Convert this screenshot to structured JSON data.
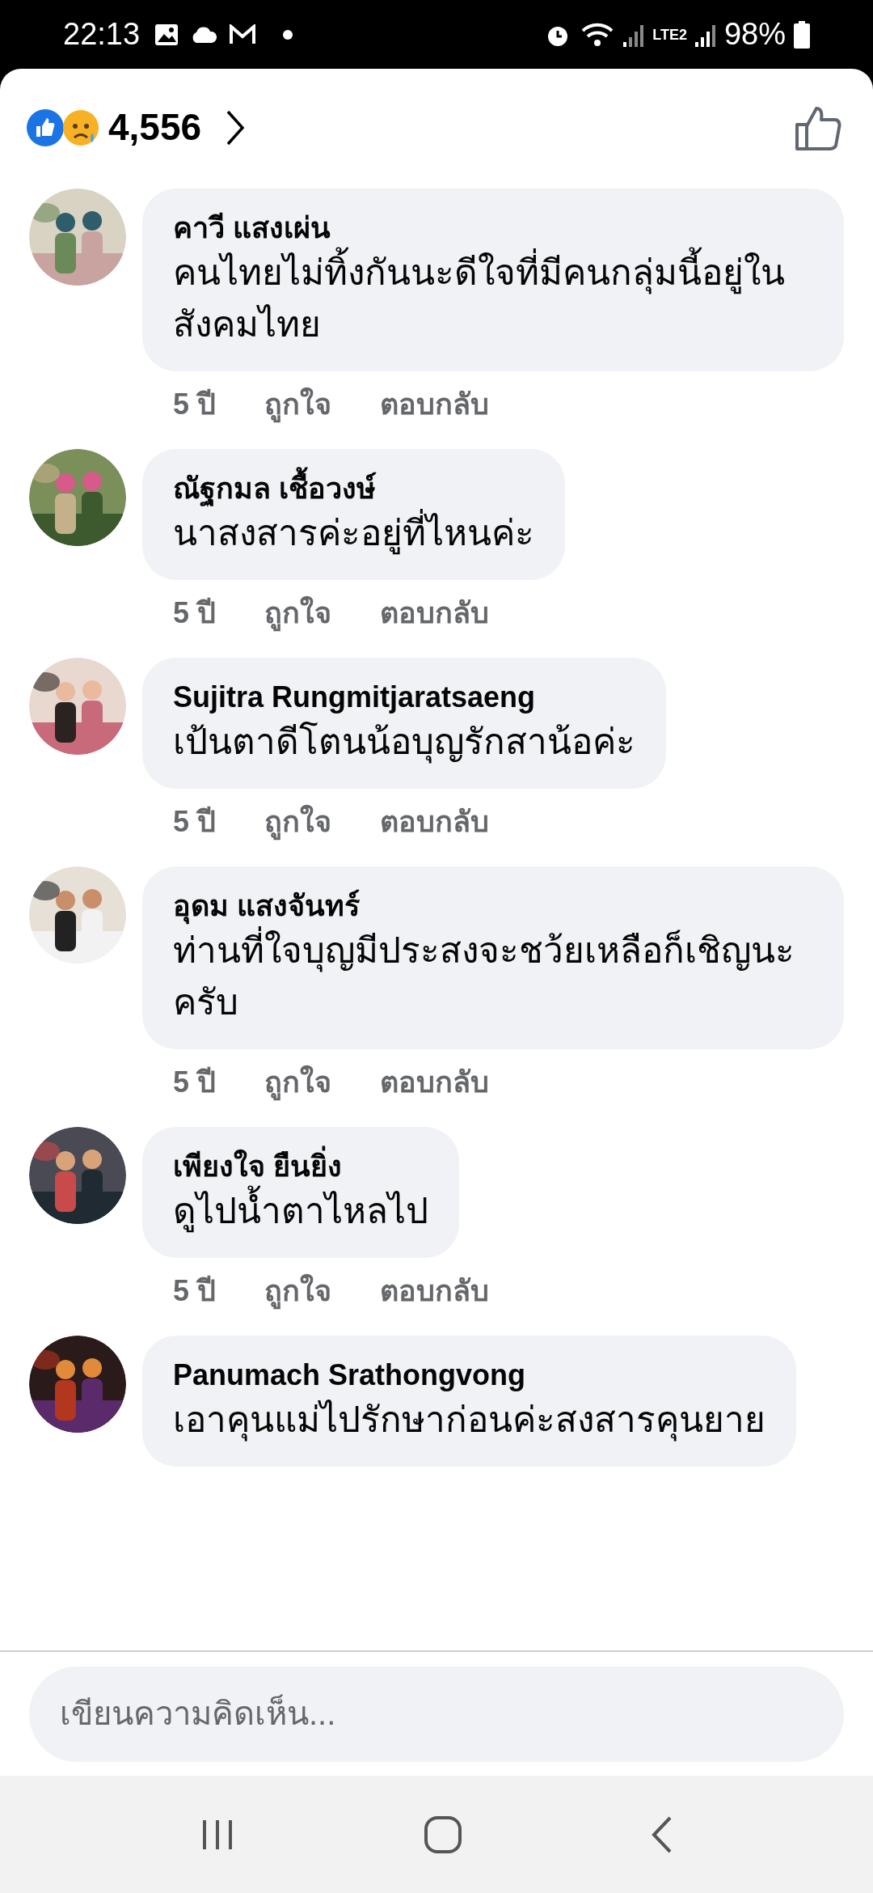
{
  "status_bar": {
    "time": "22:13",
    "network": "LTE2",
    "battery": "98%"
  },
  "reactions": {
    "count": "4,556"
  },
  "comments": [
    {
      "author": "คาวี แสงเผ่น",
      "text": "คนไทยไม่ทิ้งกันนะดีใจที่มีคนกลุ่มนี้อยู่ในสังคมไทย",
      "meta": {
        "age": "5 ปี",
        "like": "ถูกใจ",
        "reply": "ตอบกลับ"
      }
    },
    {
      "author": "ณัฐกมล เชื้อวงษ์",
      "text": "นาสงสารค่ะอยู่ที่ไหนค่ะ",
      "meta": {
        "age": "5 ปี",
        "like": "ถูกใจ",
        "reply": "ตอบกลับ"
      }
    },
    {
      "author": "Sujitra Rungmitjaratsaeng",
      "text": "เป้นตาดีโตนน้อบุญรักสาน้อค่ะ",
      "meta": {
        "age": "5 ปี",
        "like": "ถูกใจ",
        "reply": "ตอบกลับ"
      }
    },
    {
      "author": "อุดม แสงจันทร์",
      "text": "ท่านที่ใจบุญมีประสงจะชว้ยเหลือก็เชิญนะครับ",
      "meta": {
        "age": "5 ปี",
        "like": "ถูกใจ",
        "reply": "ตอบกลับ"
      }
    },
    {
      "author": "เพียงใจ ยืนยิ่ง",
      "text": "ดูไปน้ำตาไหลไป",
      "meta": {
        "age": "5 ปี",
        "like": "ถูกใจ",
        "reply": "ตอบกลับ"
      }
    },
    {
      "author": "Panumach Srathongvong",
      "text": "เอาคุนแม่ไปรักษาก่อนค่ะสงสารคุนยาย"
    }
  ],
  "composer": {
    "placeholder": "เขียนความคิดเห็น..."
  }
}
